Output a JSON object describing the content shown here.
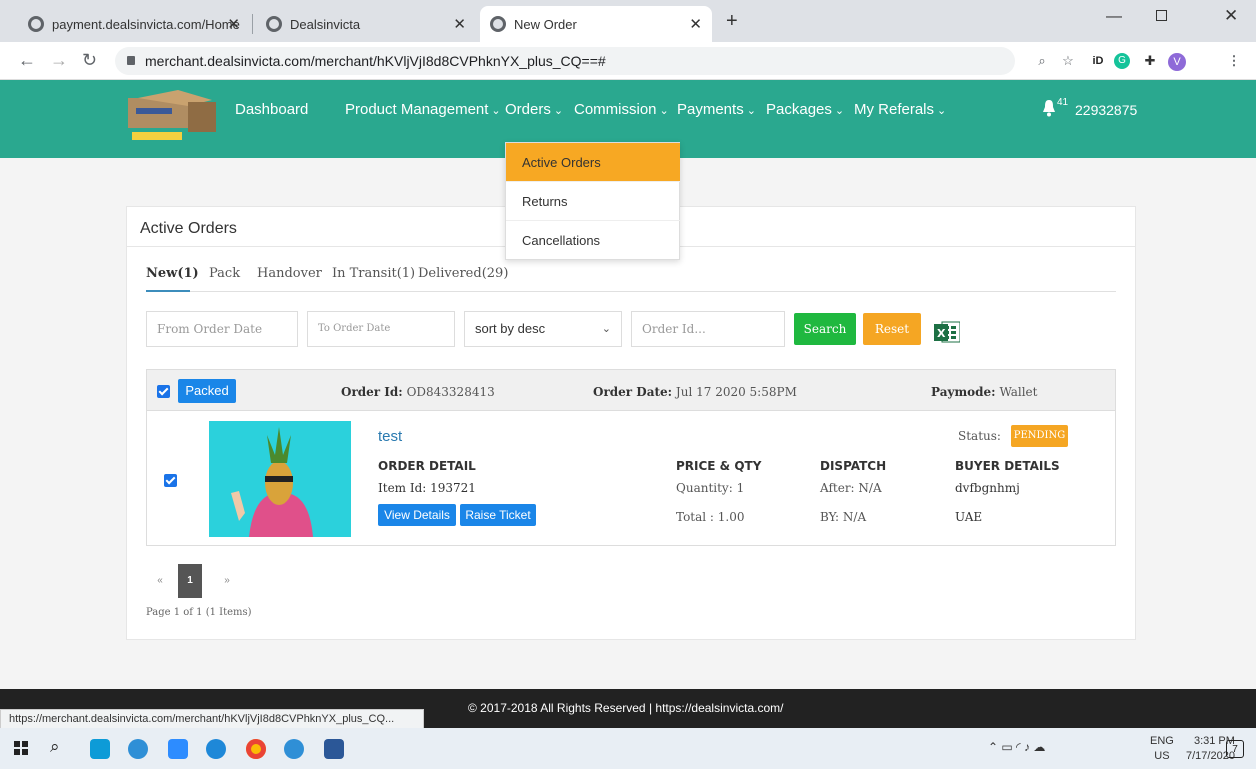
{
  "browser": {
    "tabs": [
      {
        "title": "payment.dealsinvicta.com/Home"
      },
      {
        "title": "Dealsinvicta"
      },
      {
        "title": "New Order"
      }
    ],
    "url": "merchant.dealsinvicta.com/merchant/hKVljVjI8d8CVPhknYX_plus_CQ==#",
    "status_url": "https://merchant.dealsinvicta.com/merchant/hKVljVjI8d8CVPhknYX_plus_CQ...",
    "profile_initial": "V"
  },
  "site": {
    "brand_color": "#2aa88f",
    "nav": [
      {
        "label": "Dashboard",
        "has_dropdown": false
      },
      {
        "label": "Product Management",
        "has_dropdown": true
      },
      {
        "label": "Orders",
        "has_dropdown": true
      },
      {
        "label": "Commission",
        "has_dropdown": true
      },
      {
        "label": "Payments",
        "has_dropdown": true
      },
      {
        "label": "Packages",
        "has_dropdown": true
      },
      {
        "label": "My Referals",
        "has_dropdown": true
      }
    ],
    "notification_count": "41",
    "user_id": "22932875"
  },
  "orders_menu": {
    "items": [
      "Active Orders",
      "Returns",
      "Cancellations"
    ],
    "active_index": 0
  },
  "page": {
    "title": "Active Orders",
    "tabs": [
      "New(1)",
      "Pack",
      "Handover",
      "In Transit(1)",
      "Delivered(29)"
    ],
    "active_tab": 0,
    "filters": {
      "from_placeholder": "From Order Date",
      "to_placeholder": "To Order Date",
      "sort_value": "sort by desc",
      "orderid_placeholder": "Order Id...",
      "search_label": "Search",
      "reset_label": "Reset"
    },
    "order": {
      "packed_label": "Packed",
      "order_id_label": "Order Id:",
      "order_id": "OD843328413",
      "order_date_label": "Order Date:",
      "order_date": "Jul 17 2020 5:58PM",
      "paymode_label": "Paymode:",
      "paymode": "Wallet",
      "product_name": "test",
      "order_detail_label": "ORDER DETAIL",
      "item_id": "Item Id: 193721",
      "view_details": "View Details",
      "raise_ticket": "Raise Ticket",
      "price_label": "PRICE & QTY",
      "quantity": "Quantity: 1",
      "total": "Total : 1.00",
      "dispatch_label": "DISPATCH",
      "after": "After: N/A",
      "by": "BY: N/A",
      "status_label": "Status:",
      "status": "PENDING",
      "buyer_label": "BUYER DETAILS",
      "buyer_name": "dvfbgnhmj",
      "buyer_country": "UAE"
    },
    "pagination": {
      "prev": "«",
      "current": "1",
      "next": "»",
      "info": "Page 1 of 1 (1 Items)"
    }
  },
  "footer": {
    "copyright": "© 2017-2018 All Rights Reserved | https://dealsinvicta.com/"
  },
  "taskbar": {
    "lang_top": "ENG",
    "lang_bottom": "US",
    "time": "3:31 PM",
    "date": "7/17/2020",
    "notifications": "7"
  }
}
